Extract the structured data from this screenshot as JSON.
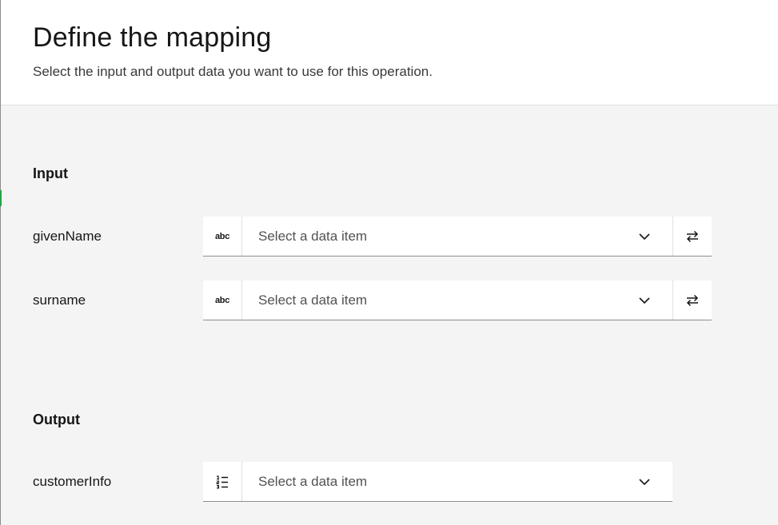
{
  "header": {
    "title": "Define the mapping",
    "subtitle": "Select the input and output data you want to use for this operation."
  },
  "input": {
    "section_title": "Input",
    "rows": [
      {
        "label": "givenName",
        "type_icon": "abc",
        "placeholder": "Select a data item"
      },
      {
        "label": "surname",
        "type_icon": "abc",
        "placeholder": "Select a data item"
      }
    ]
  },
  "output": {
    "section_title": "Output",
    "rows": [
      {
        "label": "customerInfo",
        "type_icon": "list-icon",
        "placeholder": "Select a data item"
      }
    ]
  },
  "colors": {
    "header_bg": "#ffffff",
    "page_bg": "#f4f4f4",
    "accent_marker": "#24a148"
  }
}
